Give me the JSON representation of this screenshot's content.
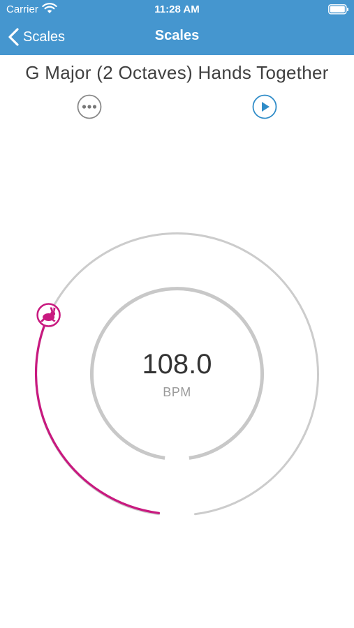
{
  "status_bar": {
    "carrier": "Carrier",
    "time": "11:28 AM",
    "icons": [
      "wifi-icon",
      "battery-icon"
    ]
  },
  "nav": {
    "back_label": "Scales",
    "title": "Scales"
  },
  "exercise": {
    "title": "G Major (2 Octaves) Hands Together"
  },
  "tempo": {
    "value": "108.0",
    "unit": "BPM",
    "dial_fill_fraction": 0.31
  },
  "colors": {
    "header": "#4596cf",
    "accent": "#c8197f",
    "play": "#2f8cc8",
    "track": "#cccccc",
    "more": "#888888"
  }
}
